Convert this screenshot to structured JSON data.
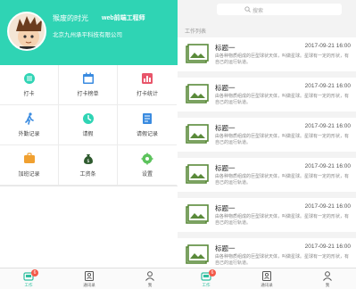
{
  "profile": {
    "name": "猴废的时光",
    "role": "web前端工程师",
    "company": "北京九州承平科技有限公司"
  },
  "grid": [
    {
      "label": "打卡",
      "icon": "clock-icon"
    },
    {
      "label": "打卡榜单",
      "icon": "calendar-icon"
    },
    {
      "label": "打卡统计",
      "icon": "stats-icon"
    },
    {
      "label": "外勤记录",
      "icon": "walking-icon"
    },
    {
      "label": "请假",
      "icon": "leave-icon"
    },
    {
      "label": "请假记录",
      "icon": "document-icon"
    },
    {
      "label": "加班记录",
      "icon": "overtime-icon"
    },
    {
      "label": "工资条",
      "icon": "money-bag-icon"
    },
    {
      "label": "设置",
      "icon": "gear-icon"
    }
  ],
  "tabs": [
    {
      "label": "工作",
      "icon": "work-icon",
      "badge": "6"
    },
    {
      "label": "通讯录",
      "icon": "contacts-icon"
    },
    {
      "label": "我",
      "icon": "person-icon"
    }
  ],
  "search": {
    "placeholder": "搜索"
  },
  "worklist": {
    "section_title": "工作列表",
    "items": [
      {
        "title": "标题一",
        "date": "2017-09-21 16:00",
        "desc": "由各种物质组成的巨型球状天体，叫做星球。星球有一定的形状，有自己的运行轨道。"
      },
      {
        "title": "标题一",
        "date": "2017-09-21 16:00",
        "desc": "由各种物质组成的巨型球状天体，叫做星球。星球有一定的形状，有自己的运行轨道。"
      },
      {
        "title": "标题一",
        "date": "2017-09-21 16:00",
        "desc": "由各种物质组成的巨型球状天体，叫做星球。星球有一定的形状，有自己的运行轨道。"
      },
      {
        "title": "标题一",
        "date": "2017-09-21 16:00",
        "desc": "由各种物质组成的巨型球状天体，叫做星球。星球有一定的形状，有自己的运行轨道。"
      },
      {
        "title": "标题一",
        "date": "2017-09-21 16:00",
        "desc": "由各种物质组成的巨型球状天体，叫做星球。星球有一定的形状，有自己的运行轨道。"
      },
      {
        "title": "标题一",
        "date": "2017-09-21 16:00",
        "desc": "由各种物质组成的巨型球状天体，叫做星球。星球有一定的形状，有自己的运行轨道。"
      }
    ]
  },
  "colors": {
    "accent": "#2fd4b4",
    "badge": "#f35a4a",
    "thumb": "#5a8a3a"
  }
}
